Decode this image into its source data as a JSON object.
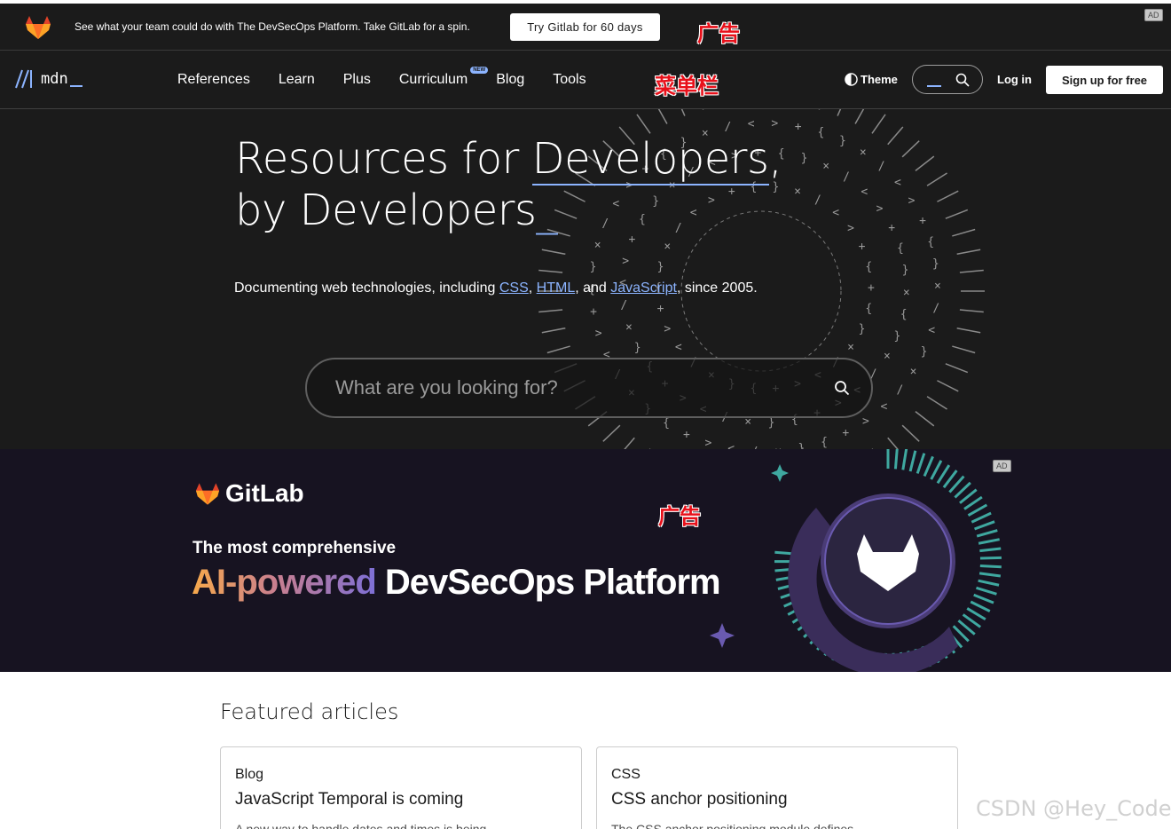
{
  "top_ad": {
    "text": "See what your team could do with The DevSecOps Platform. Take GitLab for a spin.",
    "button_label": "Try Gitlab for 60 days",
    "badge": "AD",
    "annotation": "广告"
  },
  "nav": {
    "logo_text": "mdn",
    "items": [
      {
        "label": "References"
      },
      {
        "label": "Learn"
      },
      {
        "label": "Plus"
      },
      {
        "label": "Curriculum",
        "badge": "NEW"
      },
      {
        "label": "Blog"
      },
      {
        "label": "Tools"
      }
    ],
    "annotation": "菜单栏",
    "theme_label": "Theme",
    "login_label": "Log in",
    "signup_label": "Sign up for free"
  },
  "hero": {
    "title_part1": "Resources for ",
    "title_highlight": "Developers",
    "title_part2": ",",
    "title_line2": "by Developers",
    "title_cursor": "_",
    "lead_prefix": "Documenting web technologies, including ",
    "link_css": "CSS",
    "sep1": ", ",
    "link_html": "HTML",
    "sep2": ", and ",
    "link_js": "JavaScript",
    "lead_suffix": ", since 2005.",
    "search_placeholder": "What are you looking for?"
  },
  "big_ad": {
    "badge": "AD",
    "brand": "GitLab",
    "subtitle": "The most comprehensive",
    "headline_gradient": "AI-powered",
    "headline_rest": " DevSecOps Platform",
    "annotation": "广告"
  },
  "featured": {
    "title": "Featured articles",
    "cards": [
      {
        "tag": "Blog",
        "title": "JavaScript Temporal is coming",
        "desc": "A new way to handle dates and times is being"
      },
      {
        "tag": "CSS",
        "title": "CSS anchor positioning",
        "desc": "The CSS anchor positioning module defines"
      }
    ]
  },
  "watermark": "CSDN @Hey_Coder",
  "colors": {
    "accent": "#8cb4ff",
    "dark_bg": "#1b1b1b",
    "ad_bg": "#171321",
    "annotation_red": "#e8101a"
  }
}
